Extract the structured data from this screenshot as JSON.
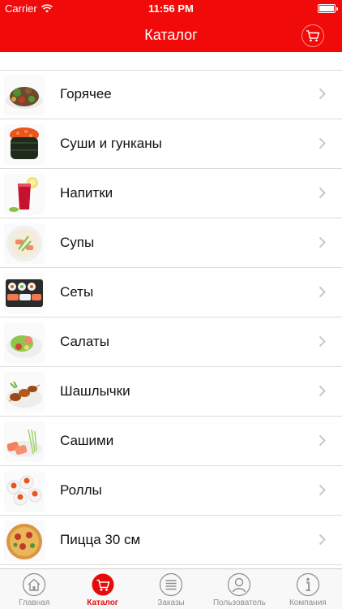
{
  "status_bar": {
    "carrier": "Carrier",
    "time": "11:56 PM"
  },
  "nav": {
    "title": "Каталог",
    "cart_icon": "cart-icon"
  },
  "categories": [
    {
      "label": "Горячее",
      "icon": "hot-dish-thumbnail"
    },
    {
      "label": "Суши и гунканы",
      "icon": "gunkan-thumbnail"
    },
    {
      "label": "Напитки",
      "icon": "drink-thumbnail"
    },
    {
      "label": "Супы",
      "icon": "soup-thumbnail"
    },
    {
      "label": "Сеты",
      "icon": "sushi-set-thumbnail"
    },
    {
      "label": "Салаты",
      "icon": "salad-thumbnail"
    },
    {
      "label": "Шашлычки",
      "icon": "skewers-thumbnail"
    },
    {
      "label": "Сашими",
      "icon": "sashimi-thumbnail"
    },
    {
      "label": "Роллы",
      "icon": "rolls-thumbnail"
    },
    {
      "label": "Пицца 30 см",
      "icon": "pizza-thumbnail"
    }
  ],
  "tabbar": {
    "home": "Главная",
    "catalog": "Каталог",
    "orders": "Заказы",
    "user": "Пользователь",
    "company": "Компания"
  },
  "colors": {
    "accent": "#f00a0a",
    "tab_active": "#e60b0b",
    "tab_inactive": "#8e8e93"
  }
}
